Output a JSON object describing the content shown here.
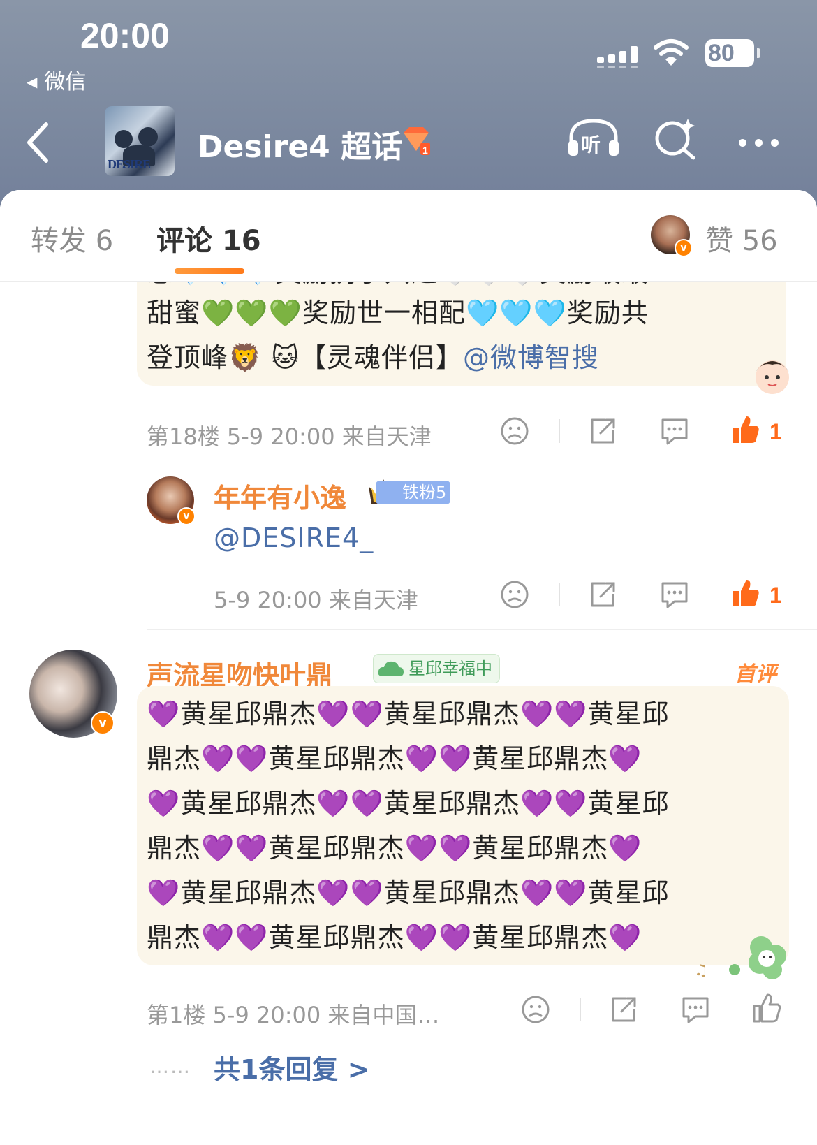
{
  "status_bar": {
    "time": "20:00",
    "back_app": "微信",
    "battery": "80"
  },
  "nav": {
    "topic_title": "Desire4 超话",
    "cover_text": "DESIRE"
  },
  "tabs": {
    "repost": "转发 6",
    "comments": "评论 16",
    "likes": "赞 56"
  },
  "comments": [
    {
      "lines": [
        "志💎💎💎奖励携手共进🤍🤍🤍奖励最最",
        "甜蜜💚💚💚奖励世一相配🩵🩵🩵奖励共",
        "登顶峰🦁 🐱【灵魂伴侣】"
      ],
      "mention": "@微博智搜",
      "meta": "第18楼 5-9 20:00 来自天津",
      "like_count": "1"
    },
    {
      "username": "年年有小逸",
      "fan_badge": "铁粉5",
      "mention": "@DESIRE4_",
      "meta": "5-9 20:00 来自天津",
      "like_count": "1"
    },
    {
      "username": "声流星吻快叶鼎_",
      "status_badge": "星邱幸福中",
      "first_tag": "首评",
      "lines": [
        "💜黄星邱鼎杰💜💜黄星邱鼎杰💜💜黄星邱",
        "鼎杰💜💜黄星邱鼎杰💜💜黄星邱鼎杰💜",
        "💜黄星邱鼎杰💜💜黄星邱鼎杰💜💜黄星邱",
        "鼎杰💜💜黄星邱鼎杰💜💜黄星邱鼎杰💜",
        "💜黄星邱鼎杰💜💜黄星邱鼎杰💜💜黄星邱",
        "鼎杰💜💜黄星邱鼎杰💜💜黄星邱鼎杰💜"
      ],
      "meta": "第1楼 5-9 20:00 来自中国…",
      "replies_link": "共1条回复 >"
    }
  ],
  "colors": {
    "accent": "#ff8200",
    "link": "#4a6ea8",
    "username": "#f0883a",
    "header_bg": "#7d8aa0"
  }
}
